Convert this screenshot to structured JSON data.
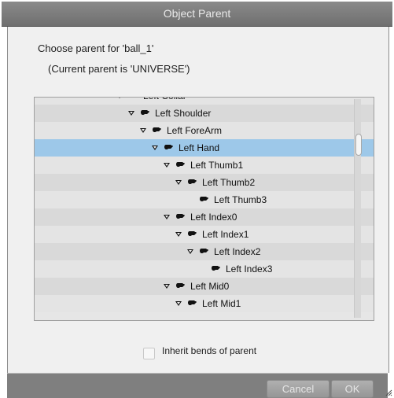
{
  "window": {
    "title": "Object Parent"
  },
  "prompt": {
    "choose": "Choose parent for 'ball_1'",
    "current": "(Current parent is 'UNIVERSE')"
  },
  "tree": {
    "items": [
      {
        "label": "Left Collar",
        "depth": 0,
        "expanded": true,
        "selected": false
      },
      {
        "label": "Left Shoulder",
        "depth": 1,
        "expanded": true,
        "selected": false
      },
      {
        "label": "Left ForeArm",
        "depth": 2,
        "expanded": true,
        "selected": false
      },
      {
        "label": "Left Hand",
        "depth": 3,
        "expanded": true,
        "selected": true
      },
      {
        "label": "Left Thumb1",
        "depth": 4,
        "expanded": true,
        "selected": false
      },
      {
        "label": "Left Thumb2",
        "depth": 5,
        "expanded": true,
        "selected": false
      },
      {
        "label": "Left Thumb3",
        "depth": 6,
        "expanded": false,
        "selected": false
      },
      {
        "label": "Left Index0",
        "depth": 4,
        "expanded": true,
        "selected": false
      },
      {
        "label": "Left Index1",
        "depth": 5,
        "expanded": true,
        "selected": false
      },
      {
        "label": "Left Index2",
        "depth": 6,
        "expanded": true,
        "selected": false
      },
      {
        "label": "Left Index3",
        "depth": 7,
        "expanded": false,
        "selected": false
      },
      {
        "label": "Left Mid0",
        "depth": 4,
        "expanded": true,
        "selected": false
      },
      {
        "label": "Left Mid1",
        "depth": 5,
        "expanded": true,
        "selected": false
      }
    ]
  },
  "options": {
    "inherit_bends_label": "Inherit bends of parent",
    "inherit_bends_checked": false
  },
  "buttons": {
    "cancel": "Cancel",
    "ok": "OK"
  },
  "icons": {
    "expand": "triangle-down-icon",
    "node": "hand-icon",
    "resize": "resize-grip-icon"
  },
  "colors": {
    "selected_row": "#9dc8e9",
    "titlebar": "#7b7b7b",
    "dialog_bg": "#f0f0f0"
  }
}
